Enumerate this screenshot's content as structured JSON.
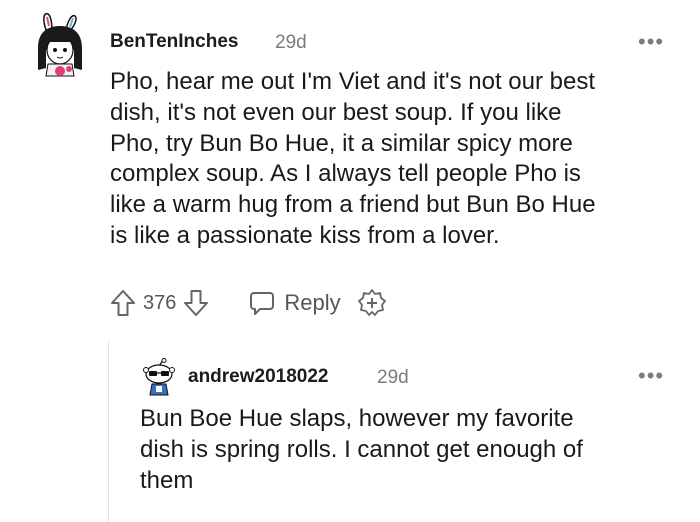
{
  "comment": {
    "username": "BenTenInches",
    "time": "29d",
    "more": "•••",
    "lines": [
      "Pho, hear me out I'm Viet and it's not our best",
      "dish, it's not even our best soup. If you like",
      "Pho, try Bun Bo Hue, it a similar spicy more",
      "complex soup. As I always tell people Pho is",
      "like a warm hug from a friend but Bun Bo Hue",
      "is like a passionate kiss from a lover."
    ],
    "votes": "376",
    "reply_label": "Reply"
  },
  "reply": {
    "username": "andrew2018022",
    "time": "29d",
    "more": "•••",
    "lines": [
      "Bun Boe Hue slaps, however my favorite",
      "dish is spring rolls. I cannot get enough of",
      "them"
    ]
  },
  "icons": {
    "upvote": "arrow-up-outline-icon",
    "downvote": "arrow-down-outline-icon",
    "reply": "speech-bubble-icon",
    "award": "award-plus-icon",
    "more": "three-dots-icon"
  }
}
